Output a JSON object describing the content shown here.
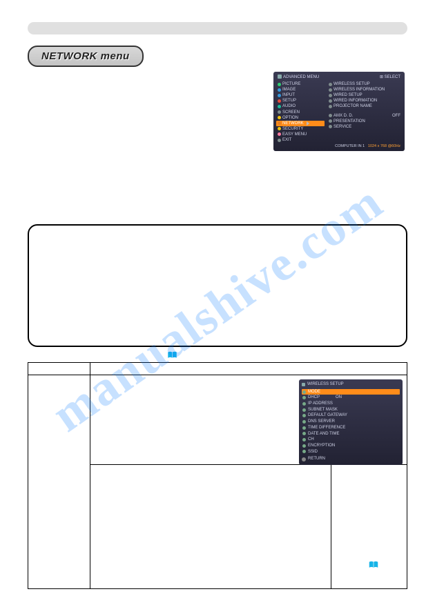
{
  "watermark": "manualshive.com",
  "heading": "NETWORK menu",
  "adv_menu": {
    "title": "ADVANCED MENU",
    "select": "SELECT",
    "left": [
      {
        "label": "PICTURE",
        "color": "b-green"
      },
      {
        "label": "IMAGE",
        "color": "b-blue"
      },
      {
        "label": "INPUT",
        "color": "b-blue"
      },
      {
        "label": "SETUP",
        "color": "b-red"
      },
      {
        "label": "AUDIO",
        "color": "b-cyan"
      },
      {
        "label": "SCREEN",
        "color": "b-grey"
      },
      {
        "label": "OPTION",
        "color": "b-yellow"
      },
      {
        "label": "NETWORK",
        "color": "b-orange",
        "hl": true
      },
      {
        "label": "SECURITY",
        "color": "b-yellow"
      },
      {
        "label": "EASY MENU",
        "color": "b-pink"
      },
      {
        "label": "EXIT",
        "color": "b-grey"
      }
    ],
    "right": [
      {
        "label": "WIRELESS SETUP"
      },
      {
        "label": "WIRELESS INFORMATION"
      },
      {
        "label": "WIRED SETUP"
      },
      {
        "label": "WIRED INFORMATION"
      },
      {
        "label": "PROJECTOR NAME"
      },
      {
        "label": ""
      },
      {
        "label": "AMX D. D.",
        "value": "OFF"
      },
      {
        "label": "PRESENTATION"
      },
      {
        "label": "SERVICE"
      }
    ],
    "footer_left": "COMPUTER IN 1",
    "footer_right": "1024 x 768 @60Hz"
  },
  "ws_menu": {
    "title": "WIRELESS SETUP",
    "rows": [
      {
        "label": "MODE",
        "hl": true
      },
      {
        "label": "DHCP",
        "value": "ON"
      },
      {
        "label": "IP ADDRESS"
      },
      {
        "label": "SUBNET MASK"
      },
      {
        "label": "DEFAULT GATEWAY"
      },
      {
        "label": "DNS SERVER"
      },
      {
        "label": "TIME DIFFERENCE"
      },
      {
        "label": "DATE AND TIME"
      },
      {
        "label": "CH"
      },
      {
        "label": "ENCRYPTION"
      },
      {
        "label": "SSID"
      }
    ],
    "return": "RETURN"
  }
}
